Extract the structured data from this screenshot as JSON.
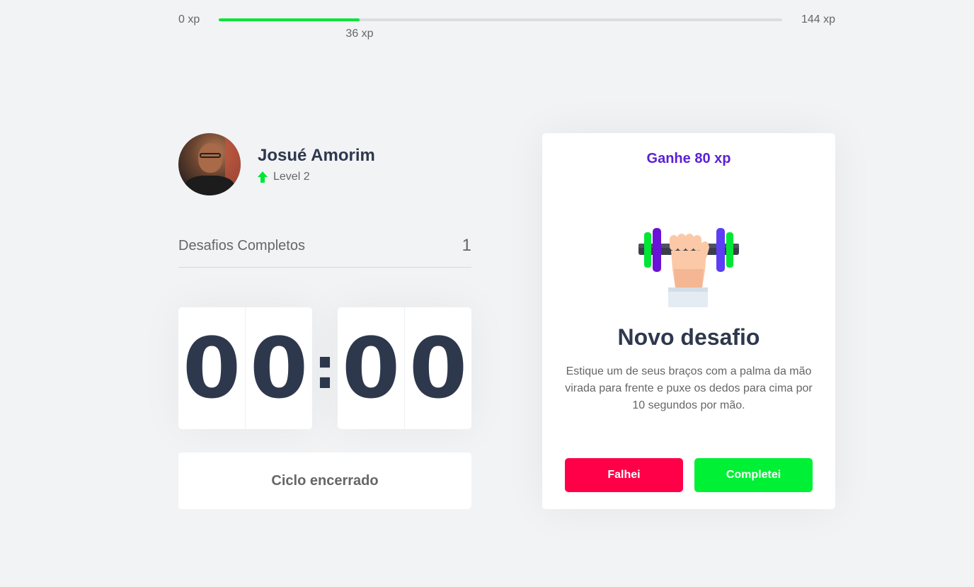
{
  "xp": {
    "min_label": "0 xp",
    "max_label": "144 xp",
    "current_label": "36 xp",
    "progress_fraction": 0.25
  },
  "profile": {
    "name": "Josué Amorim",
    "level_label": "Level 2",
    "level_icon": "level-up-arrow-icon"
  },
  "challenges_completed": {
    "label": "Desafios Completos",
    "value": "1"
  },
  "countdown": {
    "minute_left": "0",
    "minute_right": "0",
    "separator": ":",
    "second_left": "0",
    "second_right": "0"
  },
  "cycle_button": {
    "label": "Ciclo encerrado"
  },
  "challenge": {
    "reward_label": "Ganhe 80 xp",
    "icon": "dumbbell-icon",
    "title": "Novo desafio",
    "description": "Estique um de seus braços com a palma da mão virada para frente e puxe os dedos para cima por 10 segundos por mão.",
    "fail_label": "Falhei",
    "success_label": "Completei"
  },
  "colors": {
    "accent_green": "#00e635",
    "fail_red": "#ff0048",
    "success_green": "#00f035",
    "reward_purple": "#5a1fd6",
    "title_dark": "#2e384d"
  }
}
